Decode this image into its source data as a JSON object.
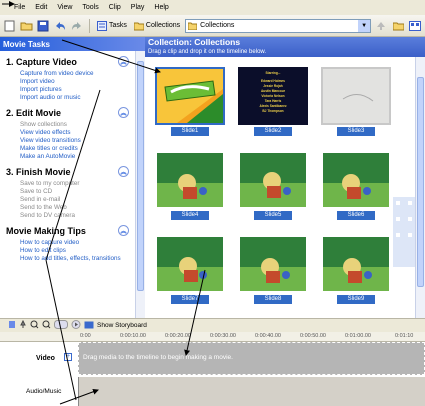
{
  "menu": [
    "File",
    "Edit",
    "View",
    "Tools",
    "Clip",
    "Play",
    "Help"
  ],
  "toolbar": {
    "tasks_label": "Tasks",
    "collections_label": "Collections",
    "combo_value": "Collections"
  },
  "taskpane": {
    "title": "Movie Tasks",
    "sections": [
      {
        "title": "1. Capture Video",
        "items": [
          "Capture from video device",
          "Import video",
          "Import pictures",
          "Import audio or music"
        ]
      },
      {
        "title": "2. Edit Movie",
        "items": [
          "Show collections",
          "View video effects",
          "View video transitions",
          "Make titles or credits",
          "Make an AutoMovie"
        ]
      },
      {
        "title": "3. Finish Movie",
        "items": [
          "Save to my computer",
          "Save to CD",
          "Send in e-mail",
          "Send to the Web",
          "Send to DV camera"
        ]
      },
      {
        "title": "Movie Making Tips",
        "items": [
          "How to capture video",
          "How to edit clips",
          "How to add titles, effects, transitions"
        ]
      }
    ]
  },
  "collection": {
    "title": "Collection: Collections",
    "subtitle": "Drag a clip and drop it on the timeline below.",
    "slides": [
      {
        "label": "Slide1",
        "kind": "title"
      },
      {
        "label": "Slide2",
        "kind": "credits"
      },
      {
        "label": "Slide3",
        "kind": "blank"
      },
      {
        "label": "Slide4",
        "kind": "scene"
      },
      {
        "label": "Slide5",
        "kind": "scene"
      },
      {
        "label": "Slide6",
        "kind": "scene"
      },
      {
        "label": "Slide7",
        "kind": "scene"
      },
      {
        "label": "Slide8",
        "kind": "scene"
      },
      {
        "label": "Slide9",
        "kind": "scene"
      }
    ],
    "credits_text": [
      "Starring...",
      "Edward Holmes",
      "Jessie Rojah",
      "Austin Mancour",
      "Victoria Nelson",
      "Tara Harris",
      "Alexis Santibanez",
      "BJ Thompson"
    ]
  },
  "timeline": {
    "show_storyboard_label": "Show Storyboard",
    "video_label": "Video",
    "audio_label": "Audio/Music",
    "drag_hint": "Drag media to the timeline to begin making a movie.",
    "ruler_ticks": [
      "0:00",
      "0:00:10.00",
      "0:00:20.00",
      "0:00:30.00",
      "0:00:40.00",
      "0:00:50.00",
      "0:01:00.00",
      "0:01:10"
    ]
  },
  "colors": {
    "accent": "#316ac5",
    "pane_blue": "#7a96df",
    "link": "#215dc6"
  }
}
